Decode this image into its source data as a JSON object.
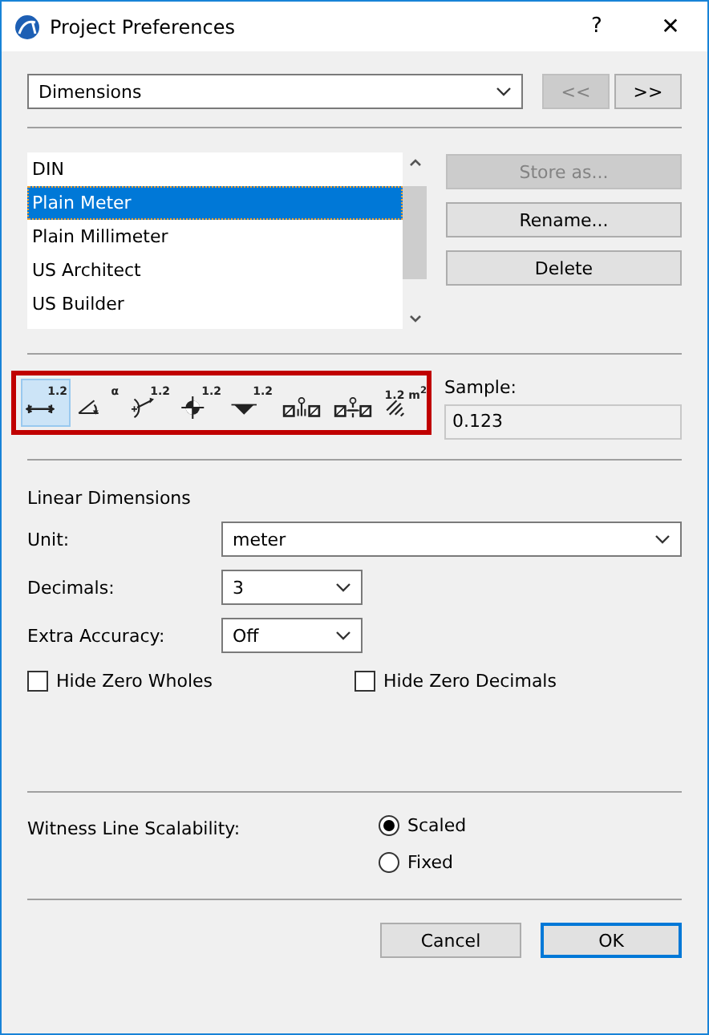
{
  "window": {
    "title": "Project Preferences",
    "help": "?",
    "close": "✕"
  },
  "page_select": {
    "value": "Dimensions"
  },
  "nav_buttons": [
    {
      "label": "<<",
      "disabled": true
    },
    {
      "label": ">>",
      "disabled": false
    }
  ],
  "presets": [
    {
      "label": "DIN",
      "selected": false
    },
    {
      "label": "Plain Meter",
      "selected": true
    },
    {
      "label": "Plain Millimeter",
      "selected": false
    },
    {
      "label": "US Architect",
      "selected": false
    },
    {
      "label": "US Builder",
      "selected": false
    }
  ],
  "preset_buttons": [
    {
      "label": "Store as...",
      "disabled": true
    },
    {
      "label": "Rename...",
      "disabled": false
    },
    {
      "label": "Delete",
      "disabled": false
    }
  ],
  "tools": [
    {
      "kind": "linear",
      "badge": "1.2",
      "selected": true
    },
    {
      "kind": "angle",
      "badge": "α",
      "selected": false
    },
    {
      "kind": "radial",
      "badge": "1.2",
      "selected": false
    },
    {
      "kind": "level",
      "badge": "1.2",
      "selected": false
    },
    {
      "kind": "elevation",
      "badge": "1.2",
      "selected": false
    },
    {
      "kind": "door",
      "selected": false
    },
    {
      "kind": "window",
      "selected": false
    },
    {
      "kind": "area",
      "badge": "1.2 m$^{2}$",
      "selected": false
    }
  ],
  "sample": {
    "label": "Sample:",
    "value": "0.123"
  },
  "section_title": "Linear Dimensions",
  "fields": [
    {
      "label": "Unit:",
      "value": "meter",
      "kind": "wide"
    },
    {
      "label": "Decimals:",
      "value": "3",
      "kind": "short"
    },
    {
      "label": "Extra Accuracy:",
      "value": "Off",
      "kind": "short"
    }
  ],
  "checkboxes": [
    {
      "label": "Hide Zero Wholes",
      "checked": false
    },
    {
      "label": "Hide Zero Decimals",
      "checked": false
    }
  ],
  "witness": {
    "label": "Witness Line Scalability:",
    "options": [
      {
        "label": "Scaled",
        "selected": true
      },
      {
        "label": "Fixed",
        "selected": false
      }
    ]
  },
  "footer_buttons": [
    {
      "label": "Cancel",
      "default": false
    },
    {
      "label": "OK",
      "default": true
    }
  ]
}
